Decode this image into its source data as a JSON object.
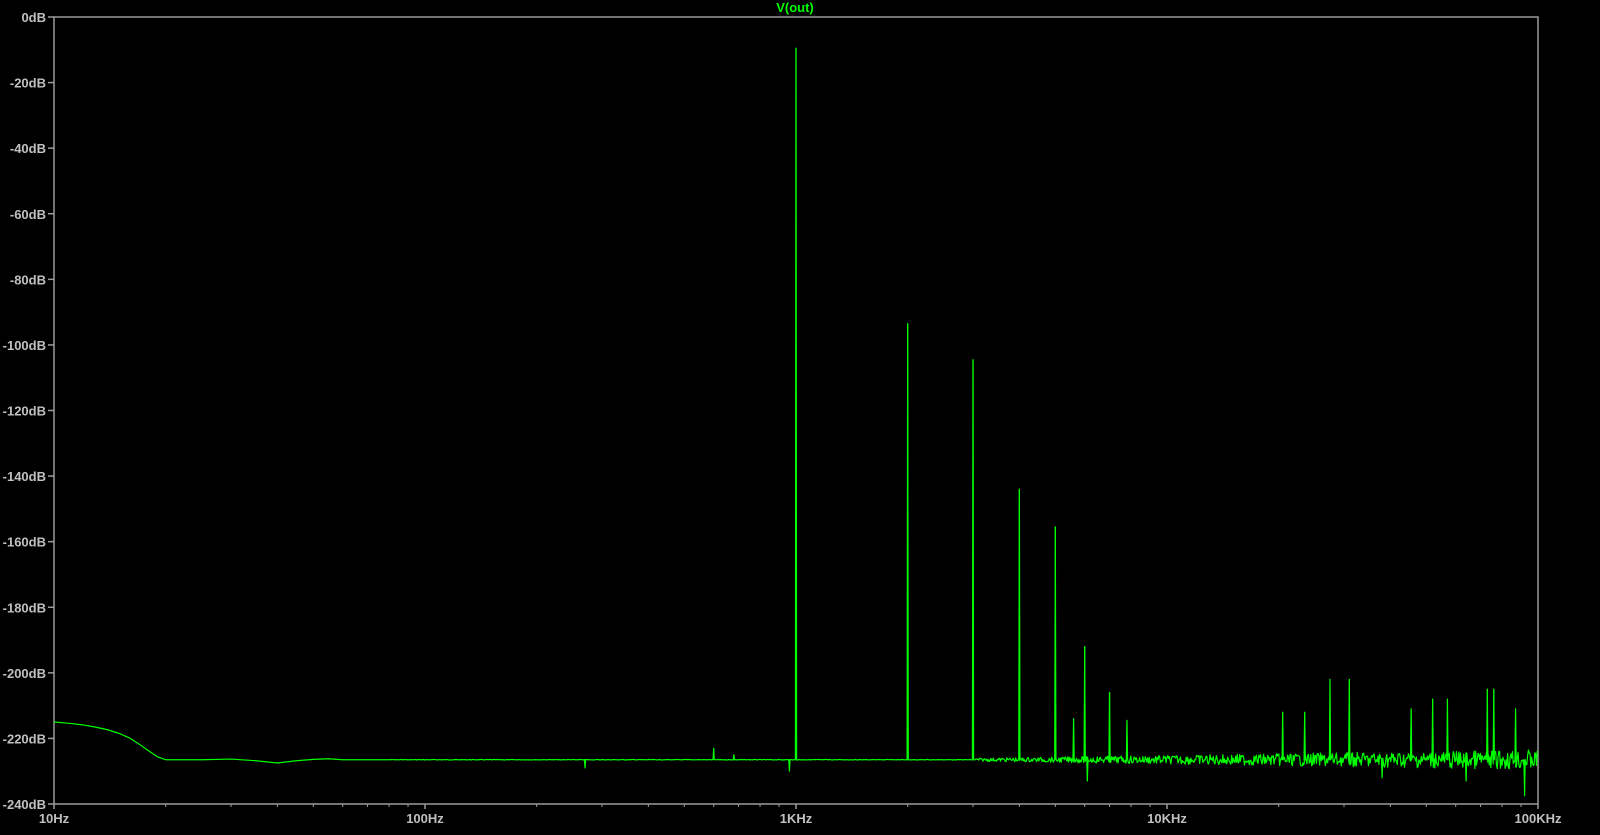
{
  "chart_data": {
    "type": "line",
    "title": "V(out)",
    "x_scale": "log",
    "y_scale": "linear",
    "xlim": [
      10,
      100000
    ],
    "ylim": [
      -240,
      0
    ],
    "grid": false,
    "y_ticks": [
      {
        "value": 0,
        "label": "0dB"
      },
      {
        "value": -20,
        "label": "-20dB"
      },
      {
        "value": -40,
        "label": "-40dB"
      },
      {
        "value": -60,
        "label": "-60dB"
      },
      {
        "value": -80,
        "label": "-80dB"
      },
      {
        "value": -100,
        "label": "-100dB"
      },
      {
        "value": -120,
        "label": "-120dB"
      },
      {
        "value": -140,
        "label": "-140dB"
      },
      {
        "value": -160,
        "label": "-160dB"
      },
      {
        "value": -180,
        "label": "-180dB"
      },
      {
        "value": -200,
        "label": "-200dB"
      },
      {
        "value": -220,
        "label": "-220dB"
      },
      {
        "value": -240,
        "label": "-240dB"
      }
    ],
    "x_ticks": [
      {
        "value": 10,
        "label": "10Hz"
      },
      {
        "value": 100,
        "label": "100Hz"
      },
      {
        "value": 1000,
        "label": "1KHz"
      },
      {
        "value": 10000,
        "label": "10KHz"
      },
      {
        "value": 100000,
        "label": "100KHz"
      }
    ],
    "series": [
      {
        "name": "V(out)",
        "color": "#00ff00",
        "noise_floor_db": -226.5,
        "low_freq_curve": [
          [
            10,
            -215
          ],
          [
            11,
            -215.4
          ],
          [
            12,
            -215.9
          ],
          [
            13,
            -216.6
          ],
          [
            14,
            -217.4
          ],
          [
            15,
            -218.5
          ],
          [
            16,
            -219.9
          ],
          [
            17,
            -221.8
          ],
          [
            18,
            -223.8
          ],
          [
            19,
            -225.6
          ],
          [
            20,
            -226.5
          ],
          [
            25,
            -226.5
          ],
          [
            30,
            -226.3
          ],
          [
            35,
            -226.8
          ],
          [
            40,
            -227.5
          ],
          [
            45,
            -226.8
          ],
          [
            50,
            -226.4
          ],
          [
            55,
            -226.2
          ],
          [
            60,
            -226.5
          ],
          [
            80,
            -226.5
          ]
        ],
        "peaks": [
          {
            "freq": 1000,
            "db": -9.5
          },
          {
            "freq": 2000,
            "db": -93.5
          },
          {
            "freq": 3000,
            "db": -104.5
          },
          {
            "freq": 4000,
            "db": -144
          },
          {
            "freq": 5000,
            "db": -155.5
          },
          {
            "freq": 6000,
            "db": -192
          },
          {
            "freq": 7000,
            "db": -206
          }
        ],
        "spurs": [
          {
            "freq": 270,
            "db": -229
          },
          {
            "freq": 600,
            "db": -223
          },
          {
            "freq": 680,
            "db": -225
          },
          {
            "freq": 960,
            "db": -230
          },
          {
            "freq": 5600,
            "db": -214
          },
          {
            "freq": 6100,
            "db": -233
          },
          {
            "freq": 7800,
            "db": -214.5
          },
          {
            "freq": 20500,
            "db": -212
          },
          {
            "freq": 23500,
            "db": -212
          },
          {
            "freq": 27500,
            "db": -202
          },
          {
            "freq": 31000,
            "db": -202
          },
          {
            "freq": 38000,
            "db": -232
          },
          {
            "freq": 45500,
            "db": -211
          },
          {
            "freq": 52000,
            "db": -208
          },
          {
            "freq": 57000,
            "db": -208
          },
          {
            "freq": 64000,
            "db": -233
          },
          {
            "freq": 73000,
            "db": -205
          },
          {
            "freq": 76000,
            "db": -205
          },
          {
            "freq": 87000,
            "db": -211
          },
          {
            "freq": 92000,
            "db": -237.5
          }
        ]
      }
    ]
  }
}
